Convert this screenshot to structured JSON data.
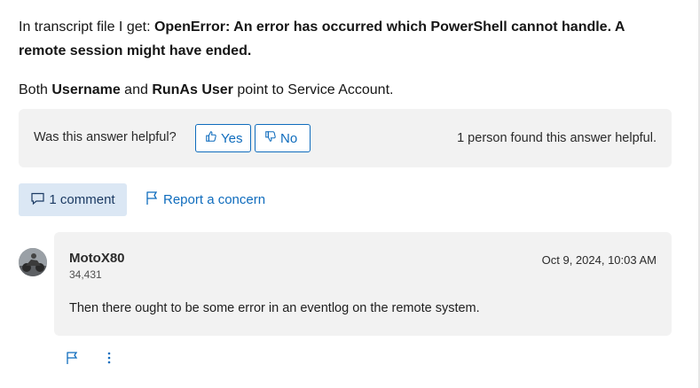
{
  "answer": {
    "p1_prefix": "In transcript file I get: ",
    "p1_bold": "OpenError: An error has occurred which PowerShell cannot handle. A remote session might have ended.",
    "p2_prefix": "Both ",
    "p2_bold1": "Username",
    "p2_mid": " and ",
    "p2_bold2": "RunAs User",
    "p2_suffix": " point to Service Account."
  },
  "helpful": {
    "question": "Was this answer helpful?",
    "yes_label": "Yes",
    "no_label": "No",
    "count_text": "1 person found this answer helpful."
  },
  "actions": {
    "comment_label": "1 comment",
    "report_label": "Report a concern"
  },
  "comment": {
    "author": "MotoX80",
    "reputation": "34,431",
    "date": "Oct 9, 2024, 10:03 AM",
    "body": "Then there ought to be some error in an eventlog on the remote system."
  },
  "icons": {
    "yes": "thumbs-up-icon",
    "no": "thumbs-down-icon",
    "comment": "comment-icon",
    "report": "flag-icon",
    "more": "more-vertical-icon"
  },
  "colors": {
    "accent": "#0f6cbd",
    "panel": "#f2f2f2",
    "comment_button_bg": "#dbe7f4"
  }
}
